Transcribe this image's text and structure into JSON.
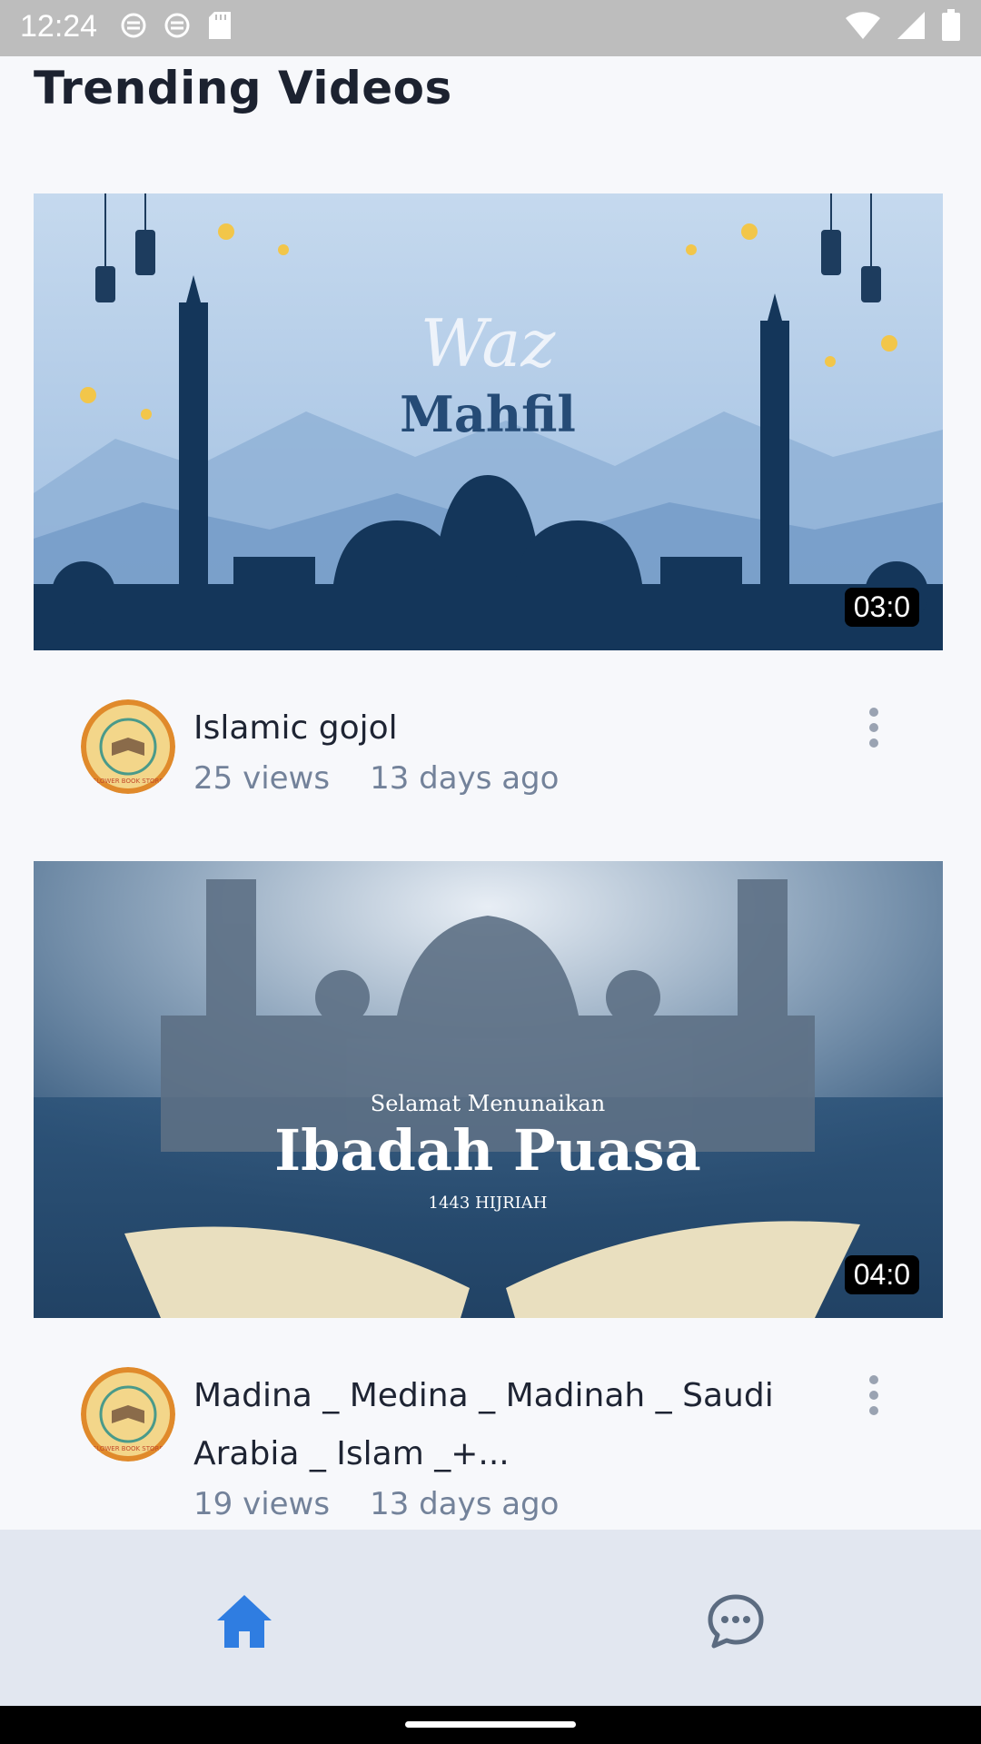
{
  "status_bar": {
    "time": "12:24",
    "left_icons": [
      "sim-card-icon",
      "sim-card-icon",
      "sd-card-icon"
    ],
    "right_icons": [
      "wifi-icon",
      "signal-icon",
      "battery-icon"
    ]
  },
  "page": {
    "title": "Trending Videos"
  },
  "videos": [
    {
      "thumbnail_text": [
        "Waz",
        "Mahfil"
      ],
      "duration": "03:0",
      "title": "Islamic gojol",
      "views": "25 views",
      "age": "13 days ago",
      "channel_logo_text": "FLOWER BOOK STORE"
    },
    {
      "thumbnail_text": [
        "Selamat Menunaikan",
        "Ibadah Puasa",
        "1443 HIJRIAH"
      ],
      "duration": "04:0",
      "title": "Madina _ Medina _ Madinah _ Saudi Arabia _ Islam _+...",
      "views": "19 views",
      "age": "13 days ago",
      "channel_logo_text": "FLOWER BOOK STORE"
    }
  ],
  "bottom_nav": {
    "items": [
      {
        "icon": "home-icon",
        "active": true
      },
      {
        "icon": "chat-icon",
        "active": false
      }
    ]
  },
  "colors": {
    "accent": "#2f7de1",
    "text_primary": "#1e2433",
    "text_secondary": "#73829a",
    "nav_background": "#e2e7f0",
    "status_bar": "#bdbdbd"
  }
}
